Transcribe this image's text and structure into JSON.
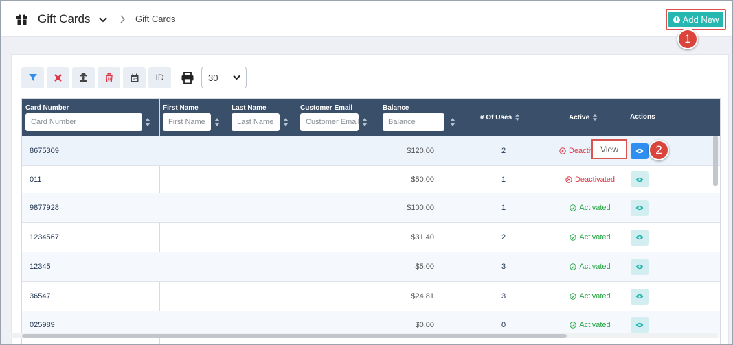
{
  "header": {
    "title": "Gift Cards",
    "breadcrumb": "Gift Cards",
    "add_new_label": "Add New",
    "callout_1": "1",
    "callout_2": "2"
  },
  "toolbar": {
    "id_label": "ID",
    "page_size": "30",
    "icons": [
      "filter-icon",
      "clear-filter-icon",
      "user-secret-icon",
      "trash-icon",
      "calendar-icon",
      "id-button",
      "print-icon"
    ]
  },
  "table": {
    "columns": {
      "card_number": "Card Number",
      "first_name": "First Name",
      "last_name": "Last Name",
      "customer_email": "Customer Email",
      "balance": "Balance",
      "uses": "# Of Uses",
      "active": "Active",
      "actions": "Actions"
    },
    "placeholders": {
      "card_number": "Card Number",
      "first_name": "First Name",
      "last_name": "Last Name",
      "customer_email": "Customer Email",
      "balance": "Balance"
    },
    "rows": [
      {
        "card_number": "8675309",
        "balance": "$120.00",
        "uses": "2",
        "status": "Deactivated",
        "status_display": "Deactiv"
      },
      {
        "card_number": "011",
        "balance": "$50.00",
        "uses": "1",
        "status": "Deactivated",
        "status_display": "Deactivated"
      },
      {
        "card_number": "9877928",
        "balance": "$100.00",
        "uses": "1",
        "status": "Activated",
        "status_display": "Activated"
      },
      {
        "card_number": "1234567",
        "balance": "$31.40",
        "uses": "2",
        "status": "Activated",
        "status_display": "Activated"
      },
      {
        "card_number": "12345",
        "balance": "$5.00",
        "uses": "3",
        "status": "Activated",
        "status_display": "Activated"
      },
      {
        "card_number": "36547",
        "balance": "$24.81",
        "uses": "3",
        "status": "Activated",
        "status_display": "Activated"
      },
      {
        "card_number": "025989",
        "balance": "$0.00",
        "uses": "0",
        "status": "Activated",
        "status_display": "Activated"
      }
    ],
    "tooltip": "View"
  },
  "colors": {
    "accent": "#26b8b0",
    "header_bg": "#3a4f69",
    "active": "#28a745",
    "inactive": "#dc3545",
    "callout": "#d9453d"
  }
}
